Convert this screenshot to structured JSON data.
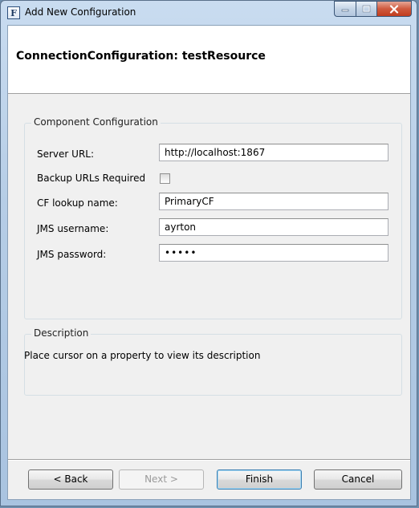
{
  "window": {
    "title": "Add New Configuration",
    "icon_letter": "F"
  },
  "header": {
    "title": "ConnectionConfiguration: testResource"
  },
  "component_config": {
    "legend": "Component Configuration",
    "server_url": {
      "label": "Server URL:",
      "value": "http://localhost:1867"
    },
    "backup_urls": {
      "label": "Backup URLs Required",
      "checked": false
    },
    "cf_lookup": {
      "label": "CF lookup name:",
      "value": "PrimaryCF"
    },
    "jms_username": {
      "label": "JMS username:",
      "value": "ayrton"
    },
    "jms_password": {
      "label": "JMS password:",
      "value": "•••••"
    }
  },
  "description": {
    "legend": "Description",
    "text": "Place cursor on a property to view its description"
  },
  "buttons": {
    "back": "< Back",
    "next": "Next >",
    "finish": "Finish",
    "cancel": "Cancel"
  }
}
